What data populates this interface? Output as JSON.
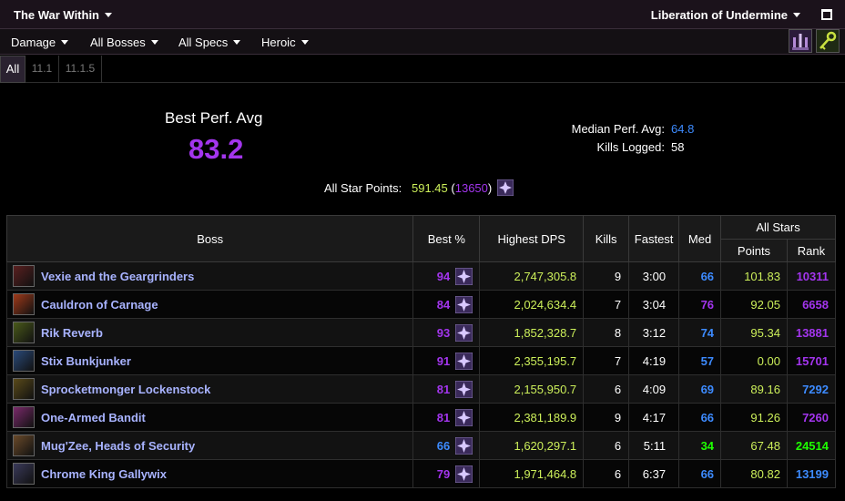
{
  "topbar": {
    "expansion": "The War Within",
    "zone": "Liberation of Undermine"
  },
  "filters": [
    "Damage",
    "All Bosses",
    "All Specs",
    "Heroic"
  ],
  "tabs": [
    "All",
    "11.1",
    "11.1.5"
  ],
  "summary": {
    "best_label": "Best Perf. Avg",
    "best_value": "83.2",
    "median_label": "Median Perf. Avg:",
    "median_value": "64.8",
    "kills_label": "Kills Logged:",
    "kills_value": "58",
    "star_label": "All Star Points:",
    "star_points": "591.45",
    "star_rank": "13650"
  },
  "table": {
    "headers": {
      "boss": "Boss",
      "best": "Best %",
      "dps": "Highest DPS",
      "kills": "Kills",
      "fastest": "Fastest",
      "med": "Med",
      "allstars": "All Stars",
      "points": "Points",
      "rank": "Rank"
    },
    "rows": [
      {
        "boss": "Vexie and the Geargrinders",
        "best": "94",
        "best_color": "#a335ee",
        "dps": "2,747,305.8",
        "kills": "9",
        "fastest": "3:00",
        "med": "66",
        "med_color": "#3d8bff",
        "points": "101.83",
        "rank": "10311",
        "rank_color": "#a335ee",
        "icon_color": "#5a2020"
      },
      {
        "boss": "Cauldron of Carnage",
        "best": "84",
        "best_color": "#a335ee",
        "dps": "2,024,634.4",
        "kills": "7",
        "fastest": "3:04",
        "med": "76",
        "med_color": "#a335ee",
        "points": "92.05",
        "rank": "6658",
        "rank_color": "#a335ee",
        "icon_color": "#a03a1a"
      },
      {
        "boss": "Rik Reverb",
        "best": "93",
        "best_color": "#a335ee",
        "dps": "1,852,328.7",
        "kills": "8",
        "fastest": "3:12",
        "med": "74",
        "med_color": "#3d8bff",
        "points": "95.34",
        "rank": "13881",
        "rank_color": "#a335ee",
        "icon_color": "#4a5a1a"
      },
      {
        "boss": "Stix Bunkjunker",
        "best": "91",
        "best_color": "#a335ee",
        "dps": "2,355,195.7",
        "kills": "7",
        "fastest": "4:19",
        "med": "57",
        "med_color": "#3d8bff",
        "points": "0.00",
        "rank": "15701",
        "rank_color": "#a335ee",
        "icon_color": "#2a4a7a"
      },
      {
        "boss": "Sprocketmonger Lockenstock",
        "best": "81",
        "best_color": "#a335ee",
        "dps": "2,155,950.7",
        "kills": "6",
        "fastest": "4:09",
        "med": "69",
        "med_color": "#3d8bff",
        "points": "89.16",
        "rank": "7292",
        "rank_color": "#3d8bff",
        "icon_color": "#5a4a1a"
      },
      {
        "boss": "One-Armed Bandit",
        "best": "81",
        "best_color": "#a335ee",
        "dps": "2,381,189.9",
        "kills": "9",
        "fastest": "4:17",
        "med": "66",
        "med_color": "#3d8bff",
        "points": "91.26",
        "rank": "7260",
        "rank_color": "#a335ee",
        "icon_color": "#7a2a6a"
      },
      {
        "boss": "Mug'Zee, Heads of Security",
        "best": "66",
        "best_color": "#3d8bff",
        "dps": "1,620,297.1",
        "kills": "6",
        "fastest": "5:11",
        "med": "34",
        "med_color": "#1eff00",
        "points": "67.48",
        "rank": "24514",
        "rank_color": "#1eff00",
        "icon_color": "#6a4a2a"
      },
      {
        "boss": "Chrome King Gallywix",
        "best": "79",
        "best_color": "#a335ee",
        "dps": "1,971,464.8",
        "kills": "6",
        "fastest": "6:37",
        "med": "66",
        "med_color": "#3d8bff",
        "points": "80.82",
        "rank": "13199",
        "rank_color": "#3d8bff",
        "icon_color": "#3a3a5a"
      }
    ]
  },
  "colors": {
    "epic": "#a335ee",
    "rare": "#3d8bff",
    "uncommon": "#1eff00",
    "dps": "#ccef5a",
    "boss_link": "#a8b3ff"
  },
  "icons": {
    "spec_icon": "spec-icon",
    "key_icon": "key-icon",
    "raid_icon": "raid-icon",
    "star_icon": "allstar-icon"
  }
}
